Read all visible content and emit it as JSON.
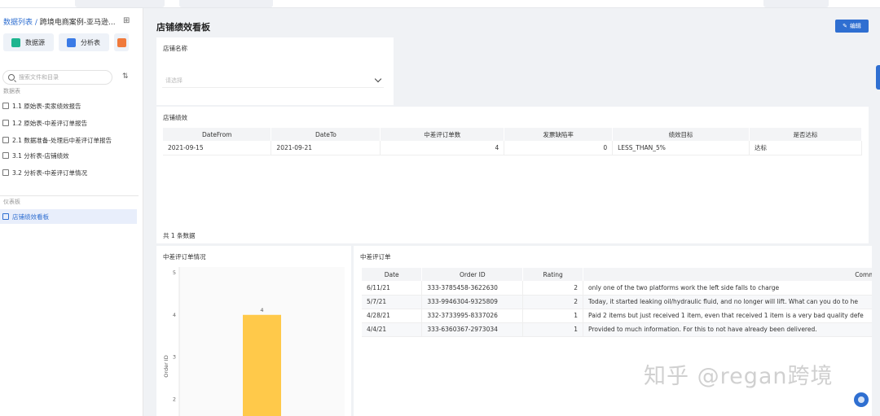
{
  "sidebar": {
    "breadcrumb_root": "数据列表 /",
    "breadcrumb_project": "跨境电商案例-亚马逊...",
    "tools": [
      {
        "label": "数据源",
        "color": "#1fb58f"
      },
      {
        "label": "分析表",
        "color": "#3b7be6"
      }
    ],
    "search_placeholder": "搜索文件和目录",
    "section_analysis": "数据表",
    "analysis_items": [
      "1.1 原始表-卖家绩效报告",
      "1.2 原始表-中差评订单报告",
      "2.1 数据准备-处理后中差评订单报告",
      "3.1 分析表-店铺绩效",
      "3.2 分析表-中差评订单情况"
    ],
    "section_dashboard": "仪表板",
    "dashboard_items": [
      "店铺绩效看板"
    ]
  },
  "main": {
    "title": "店铺绩效看板",
    "edit_label": "编辑",
    "filter": {
      "title": "店铺名称",
      "placeholder": "请选择"
    },
    "performance": {
      "title": "店铺绩效",
      "columns": [
        "DateFrom",
        "DateTo",
        "中差评订单数",
        "发票缺陷率",
        "绩效目标",
        "是否达标"
      ],
      "rows": [
        [
          "2021-09-15",
          "2021-09-21",
          "4",
          "0",
          "LESS_THAN_5%",
          "达标"
        ]
      ],
      "footer": "共 1 条数据"
    },
    "negative_chart": {
      "title": "中差评订单情况"
    },
    "negative_orders": {
      "title": "中差评订单",
      "columns": [
        "Date",
        "Order ID",
        "Rating",
        "Commen"
      ],
      "rows": [
        [
          "6/11/21",
          "333-3785458-3622630",
          "2",
          "only one of the two platforms work the left side falls to charge"
        ],
        [
          "5/7/21",
          "333-9946304-9325809",
          "2",
          "Today, it started leaking oil/hydraulic fluid, and no longer will lift. What can you do to he"
        ],
        [
          "4/28/21",
          "332-3733995-8337026",
          "1",
          "Paid 2 items but just received 1 item, even that received 1 item is a very bad quality defe"
        ],
        [
          "4/4/21",
          "333-6360367-2973034",
          "1",
          "Provided to much information. For this to not have already been delivered."
        ]
      ]
    }
  },
  "chart_data": {
    "type": "bar",
    "title": "中差评订单情况",
    "categories": [
      ""
    ],
    "values": [
      4
    ],
    "data_labels": [
      "4"
    ],
    "ylabel": "Order ID",
    "yticks": [
      2,
      3,
      4,
      5
    ],
    "ylim": [
      1.6,
      5
    ],
    "color": "#ffc94a",
    "grid": false
  },
  "watermark": "知乎 @regan跨境"
}
